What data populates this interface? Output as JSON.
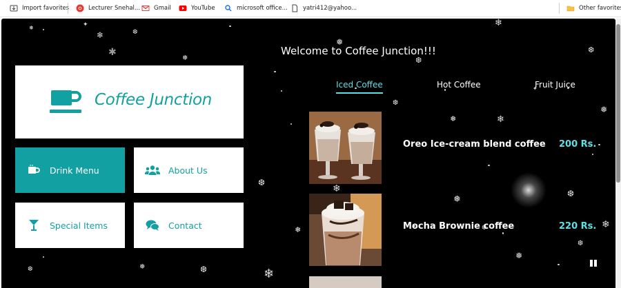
{
  "bookmarks_bar": {
    "items": [
      {
        "label": "Import favorites",
        "icon": "import-icon"
      },
      {
        "label": "Lecturer Snehal...",
        "icon": "chrome-red-icon"
      },
      {
        "label": "Gmail",
        "icon": "gmail-icon"
      },
      {
        "label": "YouTube",
        "icon": "youtube-icon"
      },
      {
        "label": "microsoft office...",
        "icon": "search-icon"
      },
      {
        "label": "yatri412@yahoo...",
        "icon": "page-icon"
      }
    ],
    "other_favorites": "Other favorites"
  },
  "page": {
    "welcome": "Welcome to Coffee Junction!!!",
    "brand": "Coffee Junction",
    "menu_tiles": [
      {
        "label": "Drink Menu",
        "icon": "mug-icon",
        "active": true
      },
      {
        "label": "About Us",
        "icon": "users-icon",
        "active": false
      },
      {
        "label": "Special Items",
        "icon": "cocktail-icon",
        "active": false
      },
      {
        "label": "Contact",
        "icon": "chat-bubbles-icon",
        "active": false
      }
    ],
    "tabs": [
      {
        "label": "Iced Coffee",
        "active": true
      },
      {
        "label": "Hot Coffee",
        "active": false
      },
      {
        "label": "Fruit Juice",
        "active": false
      }
    ],
    "items": [
      {
        "name": "Oreo Ice-cream blend coffee",
        "price": "200 Rs."
      },
      {
        "name": "Mocha Brownie coffee",
        "price": "220 Rs."
      }
    ]
  },
  "colors": {
    "accent": "#13a0a3",
    "accent_light": "#5fe0e4",
    "background": "#000000"
  }
}
